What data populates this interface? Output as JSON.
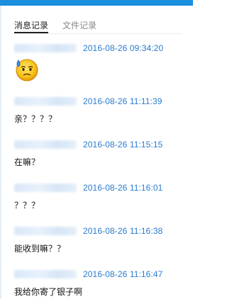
{
  "tabs": {
    "messages_label": "消息记录",
    "files_label": "文件记录"
  },
  "colors": {
    "accent": "#1a8fe0",
    "time": "#2a7bd0",
    "text": "#111111"
  },
  "messages": [
    {
      "time": "2016-08-26 09:34:20",
      "content": "",
      "emoji": "sweat-face-icon"
    },
    {
      "time": "2016-08-26 11:11:39",
      "content": "亲？？？？"
    },
    {
      "time": "2016-08-26 11:15:15",
      "content": "在嘛？"
    },
    {
      "time": "2016-08-26 11:16:01",
      "content": "？？？"
    },
    {
      "time": "2016-08-26 11:16:38",
      "content": "能收到嘛？？"
    },
    {
      "time": "2016-08-26 11:16:47",
      "content": "我给你寄了银子啊"
    }
  ]
}
